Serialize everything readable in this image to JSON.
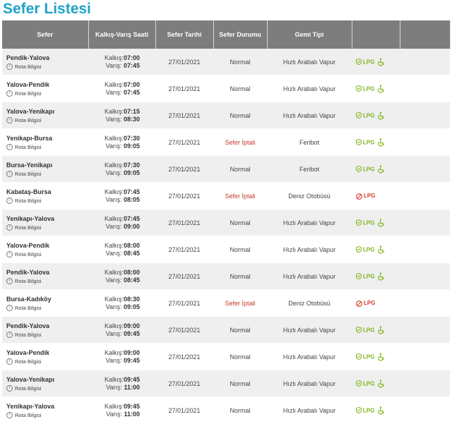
{
  "page": {
    "title": "Sefer Listesi"
  },
  "table": {
    "headers": {
      "route": "Sefer",
      "times": "Kalkış-Varış Saati",
      "date": "Sefer Tarihi",
      "status": "Sefer Durumu",
      "ship": "Gemi Tipi",
      "amenities": "",
      "extra": ""
    },
    "labels": {
      "route_info": "Rota Bilgisi",
      "departure": "Kalkış:",
      "arrival": "Varış:",
      "lpg": "LPG"
    },
    "colors": {
      "title": "#1ea3c8",
      "header_bg": "#7d7d7d",
      "lpg_allowed": "#7cb518",
      "lpg_forbidden": "#d63a2a",
      "cancelled": "#c0392b"
    },
    "rows": [
      {
        "route": "Pendik-Yalova",
        "dep": "07:00",
        "arr": "07:45",
        "date": "27/01/2021",
        "status": "Normal",
        "cancelled": false,
        "ship": "Hızlı Arabalı Vapur",
        "lpg_allowed": true,
        "wheelchair": true
      },
      {
        "route": "Yalova-Pendik",
        "dep": "07:00",
        "arr": "07:45",
        "date": "27/01/2021",
        "status": "Normal",
        "cancelled": false,
        "ship": "Hızlı Arabalı Vapur",
        "lpg_allowed": true,
        "wheelchair": true
      },
      {
        "route": "Yalova-Yenikapı",
        "dep": "07:15",
        "arr": "08:30",
        "date": "27/01/2021",
        "status": "Normal",
        "cancelled": false,
        "ship": "Hızlı Arabalı Vapur",
        "lpg_allowed": true,
        "wheelchair": true
      },
      {
        "route": "Yenikapı-Bursa",
        "dep": "07:30",
        "arr": "09:05",
        "date": "27/01/2021",
        "status": "Sefer İptali",
        "cancelled": true,
        "ship": "Feribot",
        "lpg_allowed": true,
        "wheelchair": true
      },
      {
        "route": "Bursa-Yenikapı",
        "dep": "07:30",
        "arr": "09:05",
        "date": "27/01/2021",
        "status": "Normal",
        "cancelled": false,
        "ship": "Feribot",
        "lpg_allowed": true,
        "wheelchair": true
      },
      {
        "route": "Kabataş-Bursa",
        "dep": "07:45",
        "arr": "08:05",
        "date": "27/01/2021",
        "status": "Sefer İptali",
        "cancelled": true,
        "ship": "Deniz Otobüsü",
        "lpg_allowed": false,
        "wheelchair": false
      },
      {
        "route": "Yenikapı-Yalova",
        "dep": "07:45",
        "arr": "09:00",
        "date": "27/01/2021",
        "status": "Normal",
        "cancelled": false,
        "ship": "Hızlı Arabalı Vapur",
        "lpg_allowed": true,
        "wheelchair": true
      },
      {
        "route": "Yalova-Pendik",
        "dep": "08:00",
        "arr": "08:45",
        "date": "27/01/2021",
        "status": "Normal",
        "cancelled": false,
        "ship": "Hızlı Arabalı Vapur",
        "lpg_allowed": true,
        "wheelchair": true
      },
      {
        "route": "Pendik-Yalova",
        "dep": "08:00",
        "arr": "08:45",
        "date": "27/01/2021",
        "status": "Normal",
        "cancelled": false,
        "ship": "Hızlı Arabalı Vapur",
        "lpg_allowed": true,
        "wheelchair": true
      },
      {
        "route": "Bursa-Kadıköy",
        "dep": "08:30",
        "arr": "09:05",
        "date": "27/01/2021",
        "status": "Sefer İptali",
        "cancelled": true,
        "ship": "Deniz Otobüsü",
        "lpg_allowed": false,
        "wheelchair": false
      },
      {
        "route": "Pendik-Yalova",
        "dep": "09:00",
        "arr": "09:45",
        "date": "27/01/2021",
        "status": "Normal",
        "cancelled": false,
        "ship": "Hızlı Arabalı Vapur",
        "lpg_allowed": true,
        "wheelchair": true
      },
      {
        "route": "Yalova-Pendik",
        "dep": "09:00",
        "arr": "09:45",
        "date": "27/01/2021",
        "status": "Normal",
        "cancelled": false,
        "ship": "Hızlı Arabalı Vapur",
        "lpg_allowed": true,
        "wheelchair": true
      },
      {
        "route": "Yalova-Yenikapı",
        "dep": "09:45",
        "arr": "11:00",
        "date": "27/01/2021",
        "status": "Normal",
        "cancelled": false,
        "ship": "Hızlı Arabalı Vapur",
        "lpg_allowed": true,
        "wheelchair": true
      },
      {
        "route": "Yenikapı-Yalova",
        "dep": "09:45",
        "arr": "11:00",
        "date": "27/01/2021",
        "status": "Normal",
        "cancelled": false,
        "ship": "Hızlı Arabalı Vapur",
        "lpg_allowed": true,
        "wheelchair": true
      }
    ]
  }
}
